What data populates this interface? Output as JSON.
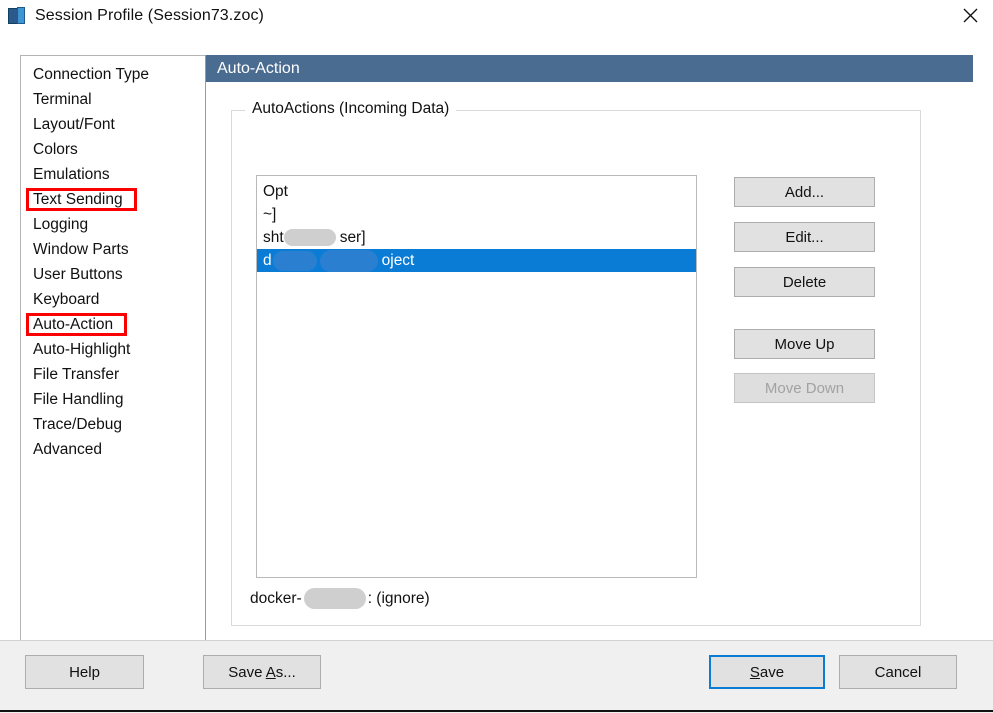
{
  "window": {
    "title": "Session Profile (Session73.zoc)",
    "icon": "session-profile-icon",
    "close_label": "×"
  },
  "sidebar": {
    "items": [
      {
        "label": "Connection Type",
        "marked": false
      },
      {
        "label": "Terminal",
        "marked": false
      },
      {
        "label": "Layout/Font",
        "marked": false
      },
      {
        "label": "Colors",
        "marked": false
      },
      {
        "label": "Emulations",
        "marked": false
      },
      {
        "label": "Text Sending",
        "marked": true
      },
      {
        "label": "Logging",
        "marked": false
      },
      {
        "label": "Window Parts",
        "marked": false
      },
      {
        "label": "User Buttons",
        "marked": false
      },
      {
        "label": "Keyboard",
        "marked": false
      },
      {
        "label": "Auto-Action",
        "marked": true
      },
      {
        "label": "Auto-Highlight",
        "marked": false
      },
      {
        "label": "File Transfer",
        "marked": false
      },
      {
        "label": "File Handling",
        "marked": false
      },
      {
        "label": "Trace/Debug",
        "marked": false
      },
      {
        "label": "Advanced",
        "marked": false
      }
    ],
    "highlight_color": "#fb0000"
  },
  "panel": {
    "header_title": "Auto-Action",
    "header_color": "#4a6c91",
    "group_legend": "AutoActions (Incoming Data)"
  },
  "list": {
    "rows": [
      {
        "prefix": "Opt",
        "suffix": "",
        "redacted": false,
        "selected": false
      },
      {
        "prefix": "~]",
        "suffix": "",
        "redacted": false,
        "selected": false
      },
      {
        "prefix": "sht",
        "suffix": "ser]",
        "redacted": true,
        "selected": false
      },
      {
        "prefix": "d",
        "suffix": "oject",
        "redacted": true,
        "selected": true
      }
    ],
    "selection_color": "#0a7cd6"
  },
  "status": {
    "prefix": "docker-",
    "suffix": ": (ignore)"
  },
  "side_buttons": [
    {
      "label": "Add...",
      "enabled": true
    },
    {
      "label": "Edit...",
      "enabled": true
    },
    {
      "label": "Delete",
      "enabled": true
    },
    {
      "label": "Move Up",
      "enabled": true
    },
    {
      "label": "Move Down",
      "enabled": false
    }
  ],
  "footer": {
    "help": "Help",
    "save_as_pre": "Save ",
    "save_as_mnem": "A",
    "save_as_post": "s...",
    "save_pre": "S",
    "save_mnem": "S",
    "save_post": "ave",
    "cancel": "Cancel",
    "focus_color": "#0a7cd6"
  }
}
